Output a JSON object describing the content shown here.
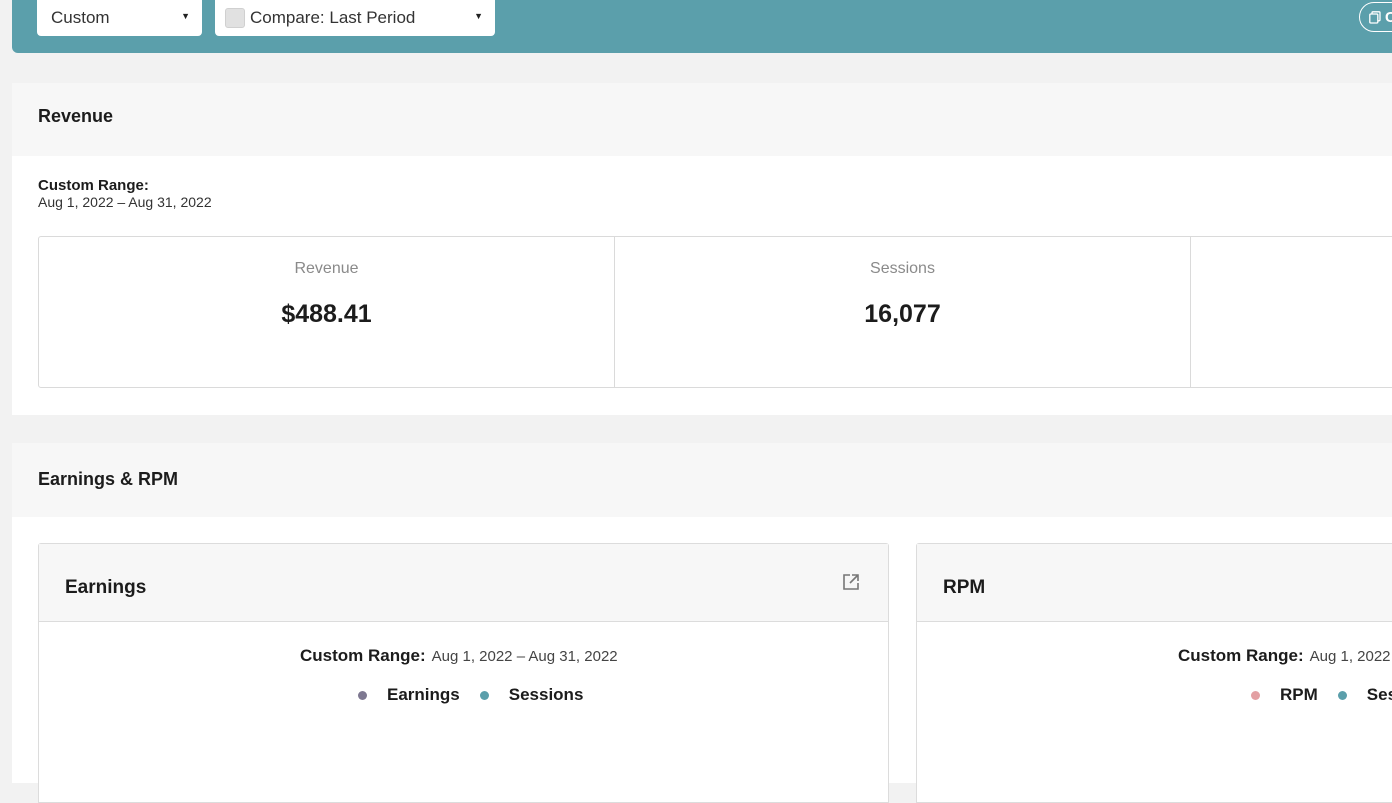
{
  "toolbar": {
    "period_select": "Custom",
    "compare_select": "Compare: Last Period",
    "copy_button": "Co"
  },
  "revenue_section": {
    "title": "Revenue",
    "range_label": "Custom Range:",
    "range_value": "Aug 1, 2022 – Aug 31, 2022",
    "stats": [
      {
        "label": "Revenue",
        "value": "$488.41"
      },
      {
        "label": "Sessions",
        "value": "16,077"
      }
    ]
  },
  "earnings_section": {
    "title": "Earnings & RPM",
    "cards": [
      {
        "title": "Earnings",
        "range_label": "Custom Range:",
        "range_value": "Aug 1, 2022 – Aug 31, 2022",
        "legend": [
          {
            "label": "Earnings",
            "color": "#7e7891"
          },
          {
            "label": "Sessions",
            "color": "#5b9fab"
          }
        ]
      },
      {
        "title": "RPM",
        "range_label": "Custom Range:",
        "range_value": "Aug 1, 2022",
        "legend": [
          {
            "label": "RPM",
            "color": "#e3a0a3"
          },
          {
            "label": "Ses",
            "color": "#5b9fab"
          }
        ]
      }
    ]
  },
  "colors": {
    "toolbar_bg": "#5b9fab",
    "page_bg": "#f2f2f2"
  }
}
